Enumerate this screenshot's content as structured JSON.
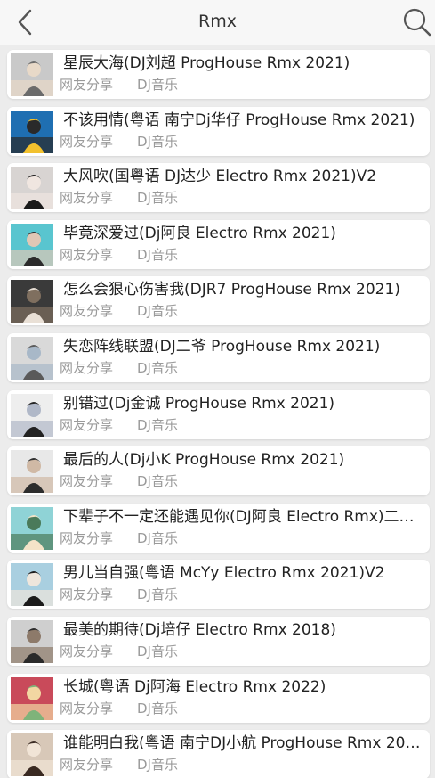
{
  "header": {
    "title": "Rmx",
    "back_icon": "chevron-left-icon",
    "search_icon": "search-icon"
  },
  "colors": {
    "header_bg": "#f7f7f7",
    "page_bg": "#ececec",
    "card_bg": "#ffffff",
    "title_text": "#222222",
    "sub_text": "#9a9a9a"
  },
  "songs": [
    {
      "title": "星辰大海(DJ刘超 ProgHouse Rmx 2021)",
      "source": "网友分享",
      "genre": "DJ音乐"
    },
    {
      "title": "不该用情(粤语 南宁Dj华仔 ProgHouse Rmx 2021)",
      "source": "网友分享",
      "genre": "DJ音乐"
    },
    {
      "title": "大风吹(国粤语 DJ达少 Electro Rmx 2021)V2",
      "source": "网友分享",
      "genre": "DJ音乐"
    },
    {
      "title": "毕竟深爱过(Dj阿良 Electro Rmx 2021)",
      "source": "网友分享",
      "genre": "DJ音乐"
    },
    {
      "title": "怎么会狠心伤害我(DJR7 ProgHouse Rmx 2021)",
      "source": "网友分享",
      "genre": "DJ音乐"
    },
    {
      "title": "失恋阵线联盟(DJ二爷 ProgHouse Rmx 2021)",
      "source": "网友分享",
      "genre": "DJ音乐"
    },
    {
      "title": "别错过(Dj金诚 ProgHouse Rmx 2021)",
      "source": "网友分享",
      "genre": "DJ音乐"
    },
    {
      "title": "最后的人(Dj小K ProgHouse Rmx 2021)",
      "source": "网友分享",
      "genre": "DJ音乐"
    },
    {
      "title": "下辈子不一定还能遇见你(DJ阿良 Electro Rmx)二…",
      "source": "网友分享",
      "genre": "DJ音乐"
    },
    {
      "title": "男儿当自强(粤语 McYy Electro Rmx 2021)V2",
      "source": "网友分享",
      "genre": "DJ音乐"
    },
    {
      "title": "最美的期待(Dj培仔 Electro Rmx 2018)",
      "source": "网友分享",
      "genre": "DJ音乐"
    },
    {
      "title": "长城(粤语 Dj阿海 Electro Rmx 2022)",
      "source": "网友分享",
      "genre": "DJ音乐"
    },
    {
      "title": "谁能明白我(粤语 南宁DJ小航 ProgHouse Rmx 20…",
      "source": "网友分享",
      "genre": "DJ音乐"
    }
  ]
}
